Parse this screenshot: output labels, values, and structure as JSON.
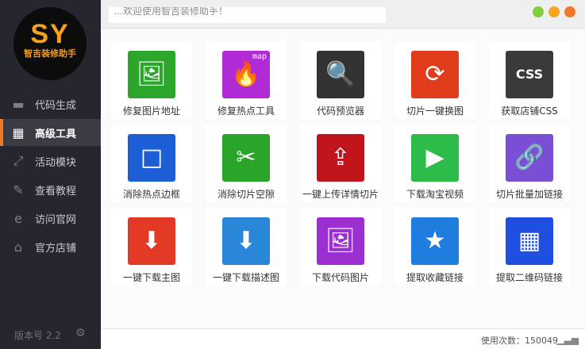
{
  "logo": {
    "title": "SY",
    "subtitle": "智吉装修助手"
  },
  "sidebar": {
    "items": [
      {
        "label": "代码生成",
        "icon": "toolbox-icon",
        "glyph": "▬"
      },
      {
        "label": "高级工具",
        "icon": "grid-icon",
        "glyph": "▦"
      },
      {
        "label": "活动模块",
        "icon": "expand-icon",
        "glyph": "⤢"
      },
      {
        "label": "查看教程",
        "icon": "pen-icon",
        "glyph": "✎"
      },
      {
        "label": "访问官网",
        "icon": "ie-icon",
        "glyph": "e"
      },
      {
        "label": "官方店铺",
        "icon": "store-icon",
        "glyph": "⌂"
      }
    ],
    "version": "版本号 2.2",
    "active": "高级工具"
  },
  "topbar": {
    "notice": "…欢迎使用智吉装修助手！"
  },
  "window_buttons": {
    "colors": [
      "#7fd03c",
      "#f5a623",
      "#f07a2a"
    ]
  },
  "tools": [
    {
      "label": "修复图片地址",
      "color": "#2ba62b",
      "glyph": "🖼"
    },
    {
      "label": "修复热点工具",
      "color": "#b02ad6",
      "glyph": "🔥",
      "badge": "map"
    },
    {
      "label": "代码预览器",
      "color": "#333333",
      "glyph": "🔍"
    },
    {
      "label": "切片一键换图",
      "color": "#e03c1c",
      "glyph": "⟳"
    },
    {
      "label": "获取店铺CSS",
      "color": "#3a3a3c",
      "glyph": "CSS"
    },
    {
      "label": "消除热点边框",
      "color": "#1b5ed6",
      "glyph": "□"
    },
    {
      "label": "消除切片空隙",
      "color": "#2aa52a",
      "glyph": "✂"
    },
    {
      "label": "一键上传详情切片",
      "color": "#c1141c",
      "glyph": "⇪"
    },
    {
      "label": "下载淘宝视频",
      "color": "#2dbb4a",
      "glyph": "▶"
    },
    {
      "label": "切片批量加链接",
      "color": "#7a4fd6",
      "glyph": "🔗"
    },
    {
      "label": "一键下载主图",
      "color": "#e33a25",
      "glyph": "⬇"
    },
    {
      "label": "一键下载描述图",
      "color": "#2a86d8",
      "glyph": "⬇"
    },
    {
      "label": "下载代码图片",
      "color": "#9b2fd2",
      "glyph": "🖼"
    },
    {
      "label": "提取收藏链接",
      "color": "#1f7de0",
      "glyph": "★"
    },
    {
      "label": "提取二维码链接",
      "color": "#1f4fe0",
      "glyph": "▦"
    }
  ],
  "footer": {
    "usage": "使用次数：150049"
  }
}
